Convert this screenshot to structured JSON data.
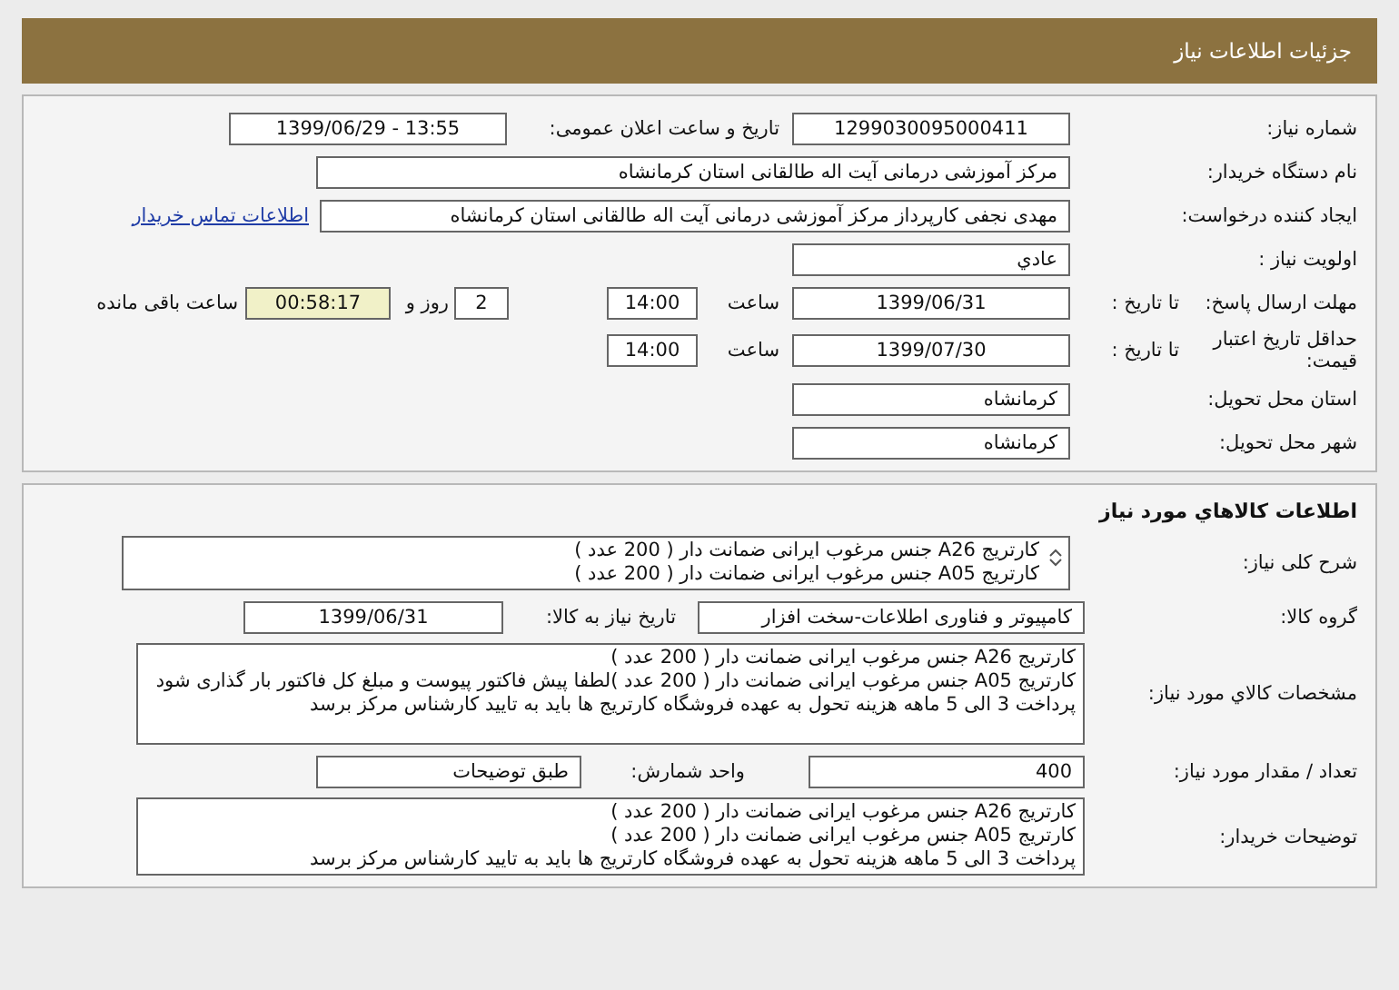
{
  "header": {
    "title": "جزئیات اطلاعات نیاز"
  },
  "need_number": {
    "label": "شماره نیاز:",
    "value": "1299030095000411"
  },
  "announce": {
    "label": "تاریخ و ساعت اعلان عمومی:",
    "value": "1399/06/29 - 13:55"
  },
  "buyer_org": {
    "label": "نام دستگاه خریدار:",
    "value": "مرکز آموزشی درمانی آیت اله طالقانی استان کرمانشاه"
  },
  "creator": {
    "label": "ایجاد کننده درخواست:",
    "value": "مهدی نجفی کارپرداز مرکز آموزشی درمانی آیت اله طالقانی استان کرمانشاه",
    "link": "اطلاعات تماس خریدار"
  },
  "priority": {
    "label": "اولویت نیاز :",
    "value": "عادي"
  },
  "reply_deadline": {
    "label": "مهلت ارسال پاسخ:",
    "to_date_label": "تا تاریخ :",
    "date": "1399/06/31",
    "time_label": "ساعت",
    "time": "14:00",
    "days": "2",
    "days_label": "روز و",
    "countdown": "00:58:17",
    "remaining_label": "ساعت باقی مانده"
  },
  "price_validity": {
    "label": "حداقل تاریخ اعتبار قیمت:",
    "to_date_label": "تا تاریخ :",
    "date": "1399/07/30",
    "time_label": "ساعت",
    "time": "14:00"
  },
  "delivery_province": {
    "label": "استان محل تحویل:",
    "value": "کرمانشاه"
  },
  "delivery_city": {
    "label": "شهر محل تحویل:",
    "value": "کرمانشاه"
  },
  "goods": {
    "title": "اطلاعات کالاهاي مورد نياز",
    "summary": {
      "label": "شرح کلی نیاز:",
      "lines": [
        "کارتریج A26 جنس مرغوب ایرانی ضمانت دار ( 200 عدد )",
        "کارتریج A05 جنس مرغوب ایرانی ضمانت دار ( 200 عدد )"
      ]
    },
    "group": {
      "label": "گروه کالا:",
      "value": "کامپیوتر و فناوری اطلاعات-سخت افزار",
      "need_date_label": "تاریخ نیاز به کالا:",
      "need_date": "1399/06/31"
    },
    "specs": {
      "label": "مشخصات کالاي مورد نياز:",
      "lines": [
        "کارتریج A26 جنس مرغوب ایرانی ضمانت دار ( 200 عدد )",
        "کارتریج A05 جنس مرغوب ایرانی ضمانت دار ( 200 عدد )لطفا پیش فاکتور پیوست و مبلغ کل فاکتور بار گذاری شود",
        "پرداخت 3 الی 5 ماهه هزینه تحول به عهده فروشگاه کارتریج ها باید به تایید کارشناس مرکز برسد"
      ]
    },
    "quantity": {
      "label": "تعداد / مقدار مورد نیاز:",
      "value": "400",
      "unit_label": "واحد شمارش:",
      "unit": "طبق توضیحات"
    },
    "buyer_notes": {
      "label": "توضیحات خریدار:",
      "lines": [
        "کارتریج A26 جنس مرغوب ایرانی ضمانت دار ( 200 عدد )",
        "کارتریج A05 جنس مرغوب ایرانی ضمانت دار ( 200 عدد )",
        "پرداخت 3 الی 5 ماهه هزینه تحول به عهده فروشگاه کارتریج ها باید به تایید کارشناس مرکز برسد"
      ]
    }
  }
}
